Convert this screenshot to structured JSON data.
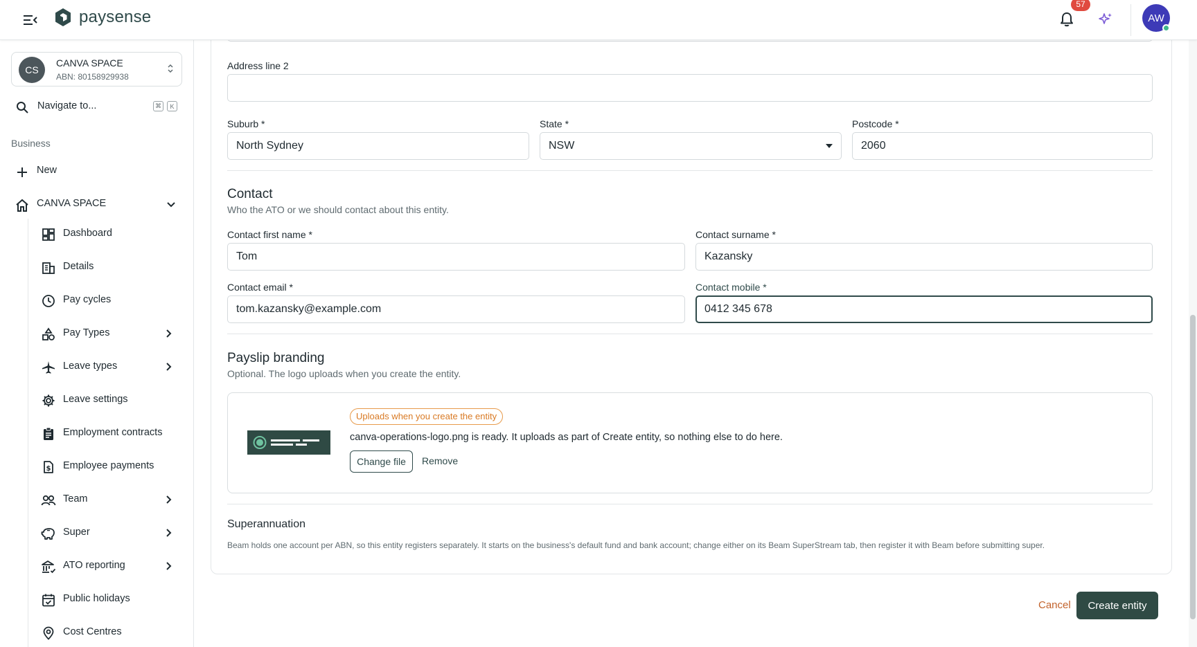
{
  "header": {
    "brand": "paysense",
    "notifications_count": "57",
    "user_initials": "AW"
  },
  "colors": {
    "brand": "#2f4a44",
    "accent_orange": "#d97a24",
    "badge_red": "#e04a3f",
    "avatar_blue": "#3d3ab7",
    "sparkle_purple": "#7b5bd6"
  },
  "sidebar": {
    "org": {
      "initials": "CS",
      "name": "CANVA SPACE",
      "abn": "ABN: 80158929938"
    },
    "navigate_label": "Navigate to...",
    "shortcut_keys": [
      "⌘",
      "K"
    ],
    "section_label": "Business",
    "new_label": "New",
    "org_nav_label": "CANVA SPACE",
    "items": [
      {
        "label": "Dashboard",
        "icon": "dashboard-icon",
        "has_children": false
      },
      {
        "label": "Details",
        "icon": "building-icon",
        "has_children": false
      },
      {
        "label": "Pay cycles",
        "icon": "clock-icon",
        "has_children": false
      },
      {
        "label": "Pay Types",
        "icon": "shapes-icon",
        "has_children": true
      },
      {
        "label": "Leave types",
        "icon": "plane-icon",
        "has_children": true
      },
      {
        "label": "Leave settings",
        "icon": "gear-icon",
        "has_children": false
      },
      {
        "label": "Employment contracts",
        "icon": "clipboard-icon",
        "has_children": false
      },
      {
        "label": "Employee payments",
        "icon": "dollar-file-icon",
        "has_children": false
      },
      {
        "label": "Team",
        "icon": "team-icon",
        "has_children": true
      },
      {
        "label": "Super",
        "icon": "piggy-bank-icon",
        "has_children": true
      },
      {
        "label": "ATO reporting",
        "icon": "bank-icon",
        "has_children": true
      },
      {
        "label": "Public holidays",
        "icon": "calendar-icon",
        "has_children": false
      },
      {
        "label": "Cost Centres",
        "icon": "location-pin-icon",
        "has_children": false
      }
    ]
  },
  "form": {
    "address_line2": {
      "label": "Address line 2",
      "value": ""
    },
    "suburb": {
      "label": "Suburb *",
      "value": "North Sydney"
    },
    "state": {
      "label": "State *",
      "value": "NSW"
    },
    "postcode": {
      "label": "Postcode *",
      "value": "2060"
    },
    "contact": {
      "title": "Contact",
      "description": "Who the ATO or we should contact about this entity.",
      "first_name": {
        "label": "Contact first name *",
        "value": "Tom"
      },
      "surname": {
        "label": "Contact surname *",
        "value": "Kazansky"
      },
      "email": {
        "label": "Contact email *",
        "value": "tom.kazansky@example.com"
      },
      "mobile": {
        "label": "Contact mobile *",
        "value": "0412 345 678"
      }
    },
    "branding": {
      "title": "Payslip branding",
      "description": "Optional. The logo uploads when you create the entity.",
      "status_pill": "Uploads when you create the entity",
      "message": "canva-operations-logo.png is ready. It uploads as part of Create entity, so nothing else to do here.",
      "change_file": "Change file",
      "remove": "Remove"
    },
    "super": {
      "title": "Superannuation",
      "description": "Beam holds one account per ABN, so this entity registers separately. It starts on the business's default fund and bank account; change either on its Beam SuperStream tab, then register it with Beam before submitting super."
    },
    "actions": {
      "cancel": "Cancel",
      "create": "Create entity"
    }
  }
}
